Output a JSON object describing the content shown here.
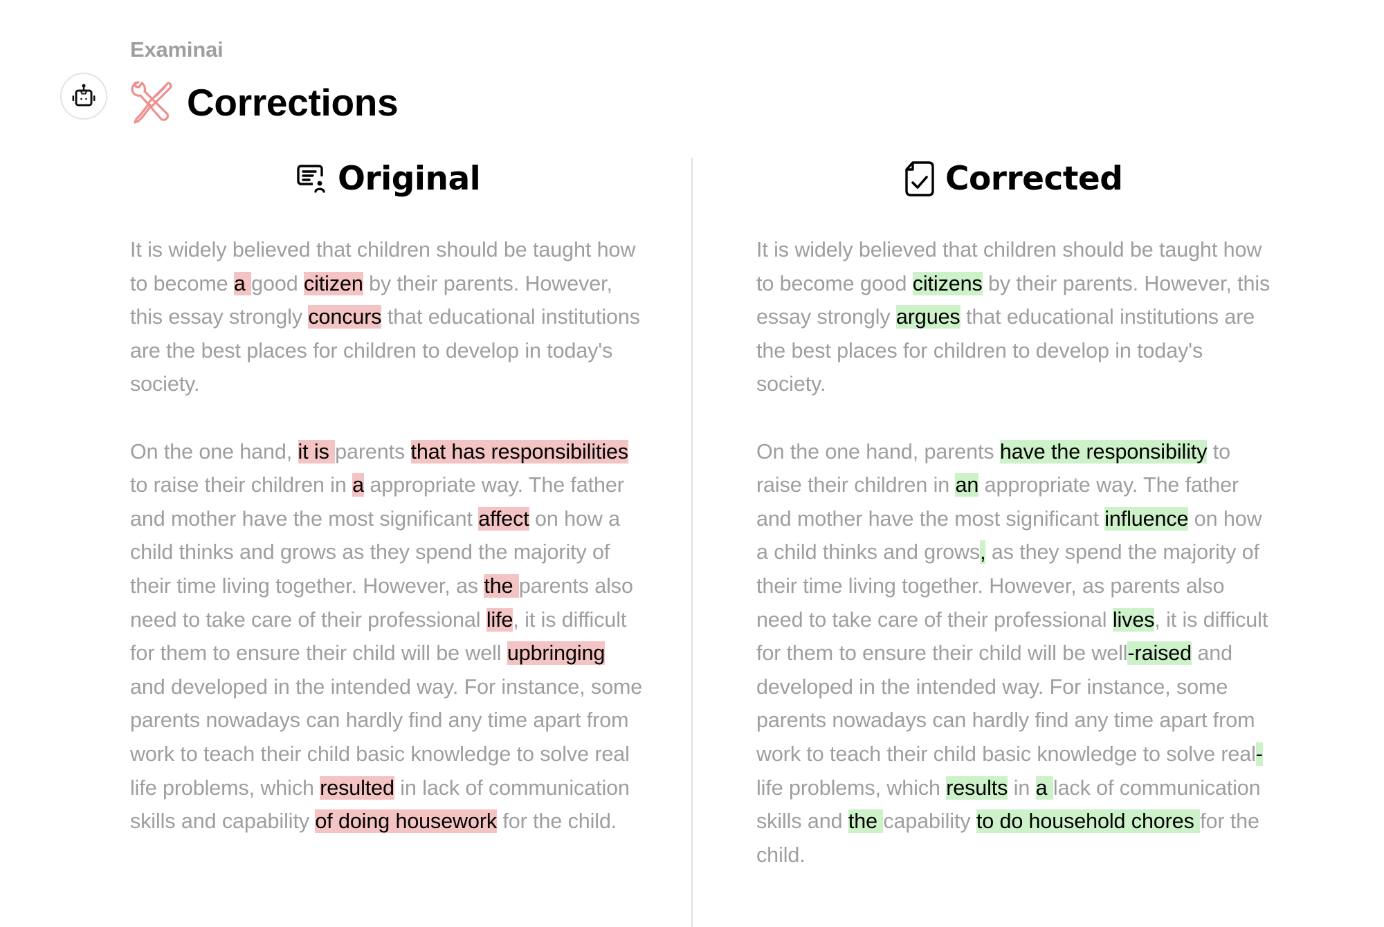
{
  "app": {
    "brand": "Examinai",
    "avatar_icon": "robot-icon"
  },
  "header": {
    "title": "Corrections",
    "title_icon": "wrench-screwdriver-icon",
    "accent_color": "#f08c8c"
  },
  "columns": {
    "original": {
      "label": "Original",
      "icon": "document-user-icon",
      "highlight_color": "#f4c3c3",
      "paragraphs": [
        [
          {
            "t": "It is widely believed that children should be taught how to become "
          },
          {
            "t": "a ",
            "hl": true
          },
          {
            "t": "good "
          },
          {
            "t": "citizen",
            "hl": true
          },
          {
            "t": " by their parents. However, this essay strongly "
          },
          {
            "t": "concurs",
            "hl": true
          },
          {
            "t": " that educational institutions are the best places for children to develop in today's society."
          }
        ],
        [
          {
            "t": "On the one hand, "
          },
          {
            "t": "it is ",
            "hl": true
          },
          {
            "t": "parents "
          },
          {
            "t": "that has responsibilities",
            "hl": true
          },
          {
            "t": " to raise their children in "
          },
          {
            "t": "a",
            "hl": true
          },
          {
            "t": " appropriate way. The father and mother have the most significant "
          },
          {
            "t": "affect",
            "hl": true
          },
          {
            "t": " on how a child thinks and grows as they spend the majority of their time living together. However, as "
          },
          {
            "t": "the ",
            "hl": true
          },
          {
            "t": "parents also need to take care of their professional "
          },
          {
            "t": "life",
            "hl": true
          },
          {
            "t": ", it is difficult for them to ensure their child will be well "
          },
          {
            "t": "upbringing ",
            "hl": true
          },
          {
            "t": "and developed in the intended way. For instance, some parents nowadays can hardly find any time apart from work to teach their child basic knowledge to solve real life problems, which "
          },
          {
            "t": "resulted",
            "hl": true
          },
          {
            "t": " in lack of communication skills and capability "
          },
          {
            "t": "of doing housework",
            "hl": true
          },
          {
            "t": " for the child."
          }
        ]
      ]
    },
    "corrected": {
      "label": "Corrected",
      "icon": "document-check-icon",
      "highlight_color": "#cdf1c9",
      "paragraphs": [
        [
          {
            "t": "It is widely believed that children should be taught how to become good "
          },
          {
            "t": "citizens",
            "hl": true
          },
          {
            "t": " by their parents. However, this essay strongly "
          },
          {
            "t": "argues",
            "hl": true
          },
          {
            "t": " that educational institutions are the best places for children to develop in today's society."
          }
        ],
        [
          {
            "t": "On the one hand, parents "
          },
          {
            "t": "have the responsibility",
            "hl": true
          },
          {
            "t": " to raise their children in "
          },
          {
            "t": "an",
            "hl": true
          },
          {
            "t": " appropriate way. The father and mother have the most significant "
          },
          {
            "t": "influence",
            "hl": true
          },
          {
            "t": " on how a child thinks and grows"
          },
          {
            "t": ",",
            "hl": true
          },
          {
            "t": " as they spend the majority of their time living together. However, as parents also need to take care of their professional "
          },
          {
            "t": "lives",
            "hl": true
          },
          {
            "t": ", it is difficult for them to ensure their child will be well"
          },
          {
            "t": "-raised",
            "hl": true
          },
          {
            "t": " and developed in the intended way. For instance, some parents nowadays can hardly find any time apart from work to teach their child basic knowledge to solve real"
          },
          {
            "t": "-",
            "hl": true
          },
          {
            "t": "life problems, which "
          },
          {
            "t": "results",
            "hl": true
          },
          {
            "t": " in "
          },
          {
            "t": "a ",
            "hl": true
          },
          {
            "t": "lack of communication skills and "
          },
          {
            "t": "the ",
            "hl": true
          },
          {
            "t": "capability "
          },
          {
            "t": "to do household chores ",
            "hl": true
          },
          {
            "t": "for the child."
          }
        ]
      ]
    }
  }
}
